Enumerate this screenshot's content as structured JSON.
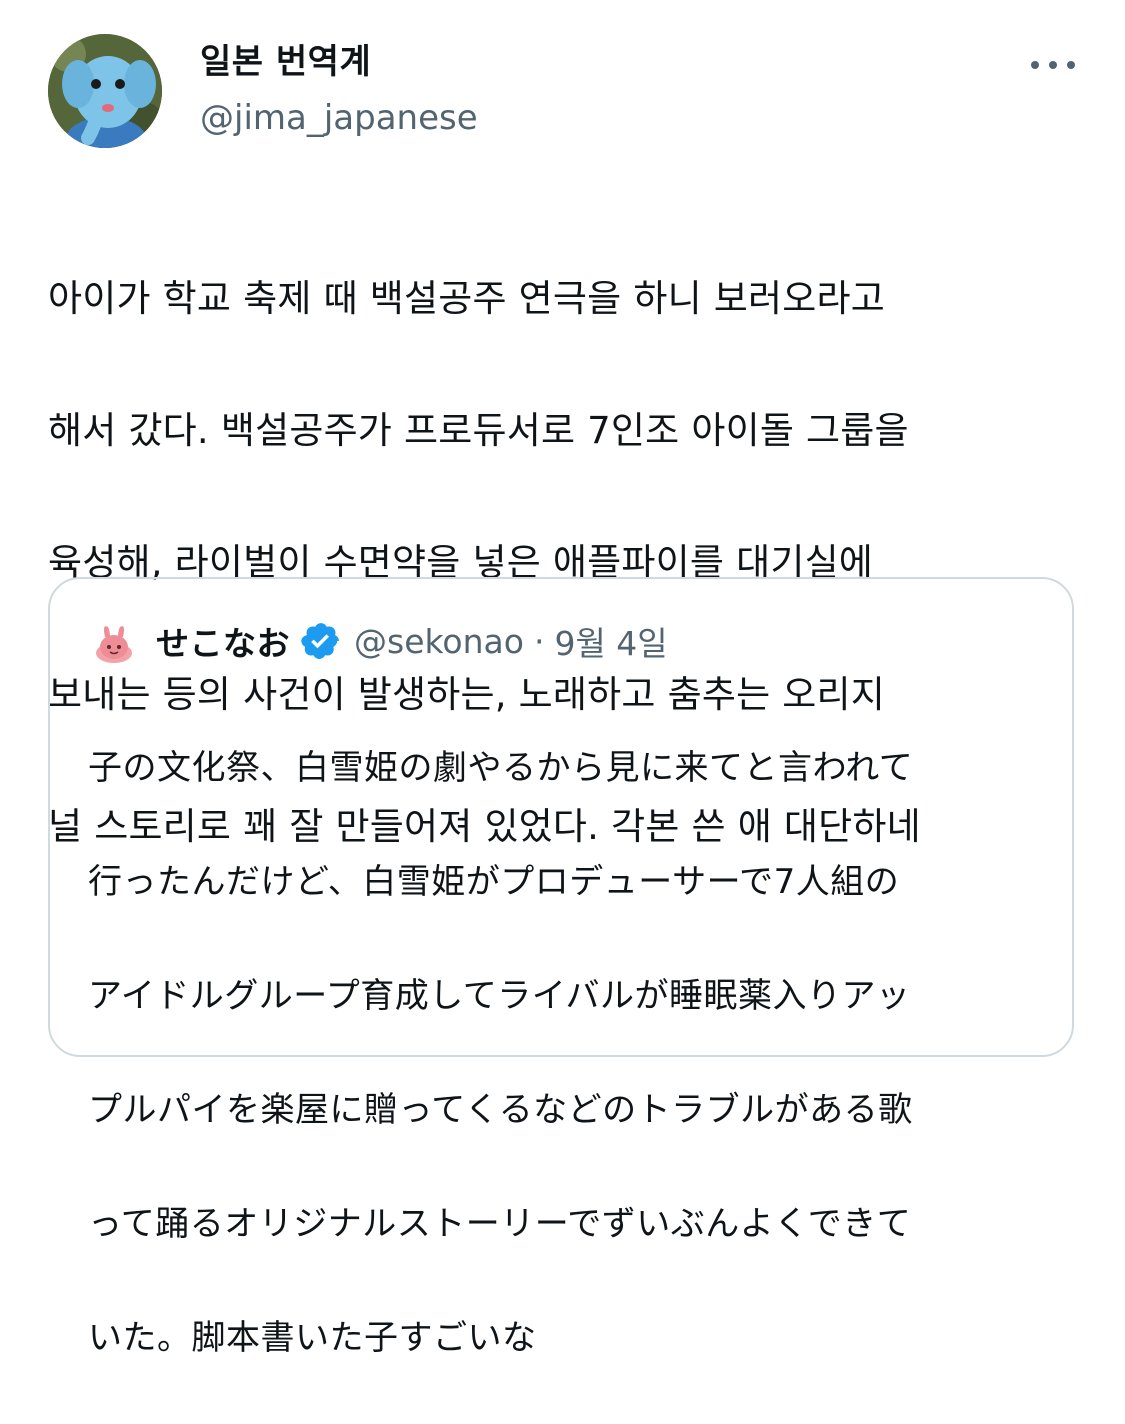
{
  "author": {
    "display_name": "일본 번역계",
    "handle": "@jima_japanese",
    "avatar_icon": "elephant-plush-icon"
  },
  "tweet": {
    "text_lines": [
      "아이가 학교 축제 때 백설공주 연극을 하니 보러오라고",
      "해서 갔다. 백설공주가 프로듀서로 7인조 아이돌 그룹을",
      "육성해, 라이벌이 수면약을 넣은 애플파이를 대기실에",
      "보내는 등의 사건이 발생하는, 노래하고 춤추는 오리지",
      "널 스토리로 꽤 잘 만들어져 있었다. 각본 쓴 애 대단하네"
    ]
  },
  "quoted_tweet": {
    "display_name": "せこなお",
    "handle": "@sekonao",
    "separator": "·",
    "date": "9월 4일",
    "verified": true,
    "avatar_icon": "pink-character-icon",
    "text_lines": [
      "子の文化祭、白雪姫の劇やるから見に来てと言われて",
      "行ったんだけど、白雪姫がプロデューサーで7人組の",
      "アイドルグループ育成してライバルが睡眠薬入りアッ",
      "プルパイを楽屋に贈ってくるなどのトラブルがある歌",
      "って踊るオリジナルストーリーでずいぶんよくできて",
      "いた。脚本書いた子すごいな"
    ]
  },
  "colors": {
    "text_primary": "#0f1419",
    "text_secondary": "#536471",
    "border": "#cfd9de",
    "verified_blue": "#1d9bf0"
  }
}
